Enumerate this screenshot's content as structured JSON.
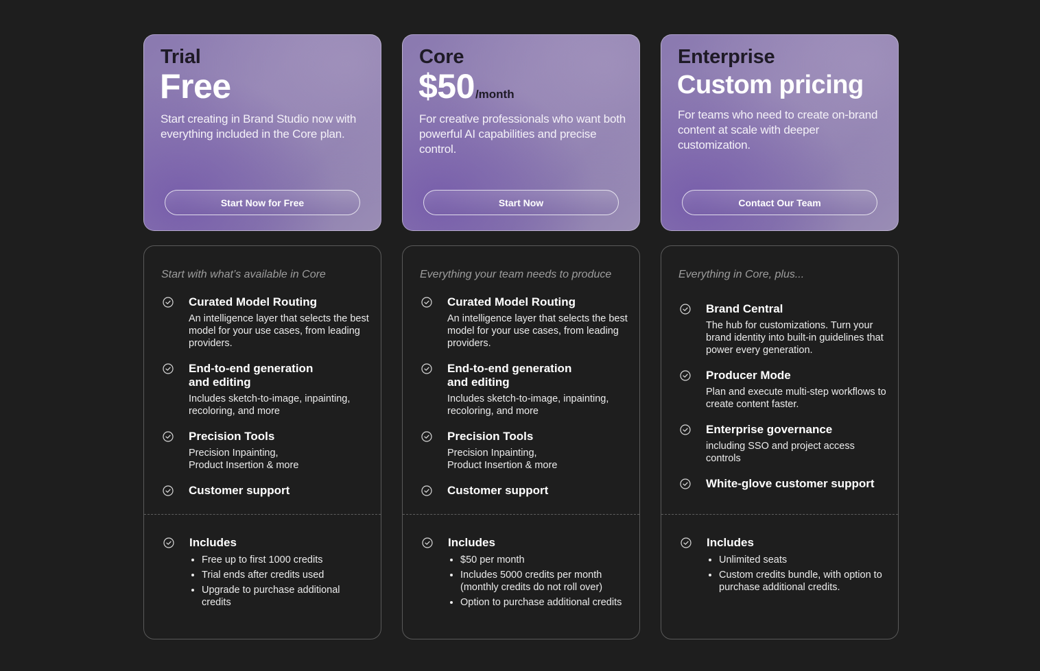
{
  "plans": [
    {
      "name": "Trial",
      "price": "Free",
      "price_unit": "",
      "description": "Start creating in Brand Studio now with everything included in the Core plan.",
      "cta": "Start Now for Free",
      "intro": "Start with what’s available in Core",
      "features": [
        {
          "title": "Curated Model Routing",
          "desc": "An intelligence layer that selects the best model for your use cases, from leading providers."
        },
        {
          "title": "End-to-end generation\nand editing",
          "desc": "Includes sketch-to-image, inpainting, recoloring, and more"
        },
        {
          "title": "Precision Tools",
          "desc": "Precision Inpainting,\nProduct Insertion & more"
        },
        {
          "title": "Customer support",
          "desc": ""
        }
      ],
      "includes_title": "Includes",
      "includes": [
        "Free up to first 1000 credits",
        "Trial ends after credits used",
        "Upgrade to purchase additional credits"
      ]
    },
    {
      "name": "Core",
      "price": "$50",
      "price_unit": "/month",
      "description": "For creative professionals who want both powerful AI capabilities and precise control.",
      "cta": "Start Now",
      "intro": "Everything your team needs to produce",
      "features": [
        {
          "title": "Curated Model Routing",
          "desc": "An intelligence layer that selects the best model for your use cases, from leading providers."
        },
        {
          "title": "End-to-end generation\nand editing",
          "desc": "Includes sketch-to-image, inpainting, recoloring, and more"
        },
        {
          "title": "Precision Tools",
          "desc": "Precision Inpainting,\nProduct Insertion & more"
        },
        {
          "title": "Customer support",
          "desc": ""
        }
      ],
      "includes_title": "Includes",
      "includes": [
        "$50 per month",
        "Includes 5000 credits per month (monthly credits do not roll over)",
        "Option to purchase additional credits"
      ]
    },
    {
      "name": "Enterprise",
      "price": "Custom pricing",
      "price_unit": "",
      "description": "For teams who need to create on-brand content at scale with deeper customization.",
      "cta": "Contact Our Team",
      "intro": "Everything in Core, plus...",
      "features": [
        {
          "title": "Brand Central",
          "desc": "The hub for customizations. Turn your brand identity into built-in guidelines that power every generation."
        },
        {
          "title": "Producer Mode",
          "desc": "Plan and execute multi-step workflows to create content faster."
        },
        {
          "title": "Enterprise governance",
          "desc": "including SSO and project access controls"
        },
        {
          "title": "White-glove customer support",
          "desc": ""
        }
      ],
      "includes_title": "Includes",
      "includes": [
        "Unlimited seats",
        "Custom credits bundle, with option to purchase additional credits."
      ]
    }
  ],
  "icons": {
    "feature_check": "check-circle-icon"
  }
}
